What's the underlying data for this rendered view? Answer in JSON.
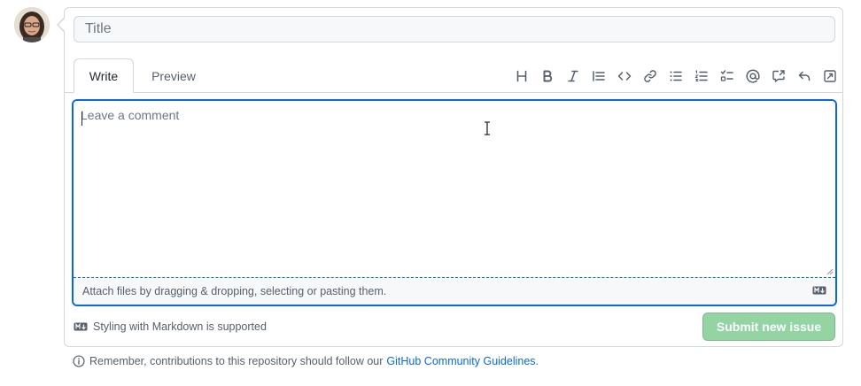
{
  "form": {
    "title_placeholder": "Title",
    "title_value": "",
    "tabs": [
      {
        "label": "Write",
        "selected": true
      },
      {
        "label": "Preview",
        "selected": false
      }
    ],
    "toolbar_icons": [
      "heading-icon",
      "bold-icon",
      "italic-icon",
      "quote-icon",
      "code-icon",
      "link-icon",
      "bulleted-list-icon",
      "numbered-list-icon",
      "task-list-icon",
      "mention-icon",
      "cross-reference-icon",
      "reply-icon",
      "fullscreen-icon"
    ],
    "comment_placeholder": "Leave a comment",
    "comment_value": "",
    "attach_text": "Attach files by dragging & dropping, selecting or pasting them.",
    "markdown_note": "Styling with Markdown is supported",
    "submit_label": "Submit new issue",
    "submit_enabled": false
  },
  "guidelines": {
    "text": "Remember, contributions to this repository should follow our",
    "link_label": "GitHub Community Guidelines",
    "suffix": "."
  },
  "colors": {
    "accent": "#0969da",
    "submit_disabled": "#94d3a2",
    "border": "#d0d7de"
  }
}
